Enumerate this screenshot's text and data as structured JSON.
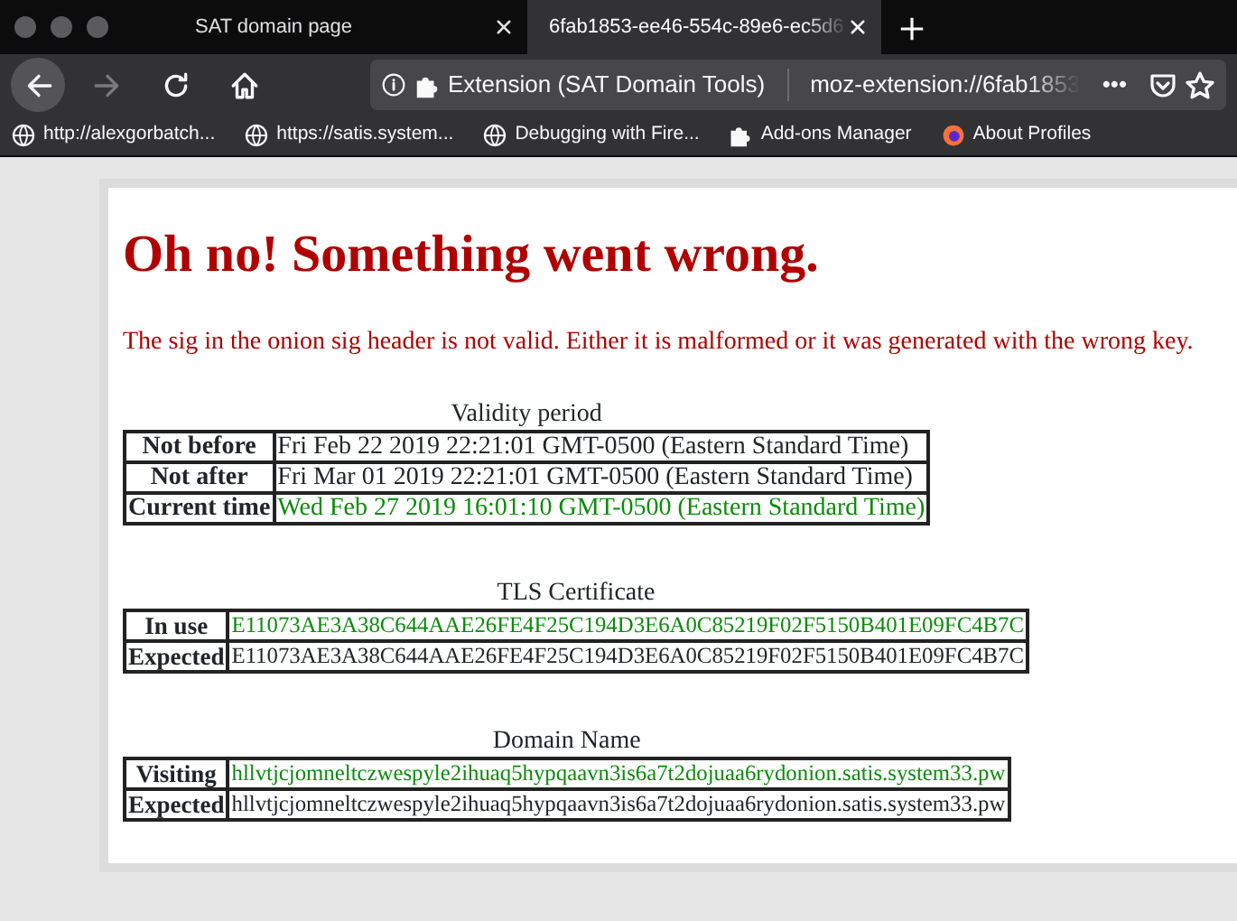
{
  "browser": {
    "tabs": [
      {
        "title": "SAT domain page",
        "selected": false
      },
      {
        "title": "6fab1853-ee46-554c-89e6-ec5d6",
        "selected": true
      }
    ],
    "nav": [
      {
        "kind": "back",
        "disabled": false
      },
      {
        "kind": "forward",
        "disabled": true
      },
      {
        "kind": "reload",
        "disabled": false
      },
      {
        "kind": "home",
        "disabled": false
      }
    ],
    "identity": "Extension (SAT Domain Tools)",
    "url": "moz-extension://6fab1853",
    "page_actions": "•••",
    "bookmarks": [
      {
        "kind": "globe",
        "label": "http://alexgorbatch..."
      },
      {
        "kind": "globe",
        "label": "https://satis.system..."
      },
      {
        "kind": "globe",
        "label": "Debugging with Fire..."
      },
      {
        "kind": "addon",
        "label": "Add-ons Manager"
      },
      {
        "kind": "firefox",
        "label": "About Profiles"
      }
    ]
  },
  "page": {
    "heading": "Oh no! Something went wrong.",
    "message": "The sig in the onion sig header is not valid. Either it is malformed or it was generated with the wrong key.",
    "tables": [
      {
        "caption": "Validity period",
        "rows": [
          {
            "label": "Not before",
            "value": "Fri Feb 22 2019 22:21:01 GMT-0500 (Eastern Standard Time)",
            "highlighted": false
          },
          {
            "label": "Not after",
            "value": "Fri Mar 01 2019 22:21:01 GMT-0500 (Eastern Standard Time)",
            "highlighted": false
          },
          {
            "label": "Current time",
            "value": "Wed Feb 27 2019 16:01:10 GMT-0500 (Eastern Standard Time)",
            "highlighted": true
          }
        ]
      },
      {
        "caption": "TLS Certificate",
        "rows": [
          {
            "label": "In use",
            "value": "E11073AE3A38C644AAE26FE4F25C194D3E6A0C85219F02F5150B401E09FC4B7C",
            "highlighted": true
          },
          {
            "label": "Expected",
            "value": "E11073AE3A38C644AAE26FE4F25C194D3E6A0C85219F02F5150B401E09FC4B7C",
            "highlighted": false
          }
        ]
      },
      {
        "caption": "Domain Name",
        "rows": [
          {
            "label": "Visiting",
            "value": "hllvtjcjomneltczwespyle2ihuaq5hypqaavn3is6a7t2dojuaa6rydonion.satis.system33.pw",
            "highlighted": true
          },
          {
            "label": "Expected",
            "value": "hllvtjcjomneltczwespyle2ihuaq5hypqaavn3is6a7t2dojuaa6rydonion.satis.system33.pw",
            "highlighted": false
          }
        ]
      }
    ]
  }
}
